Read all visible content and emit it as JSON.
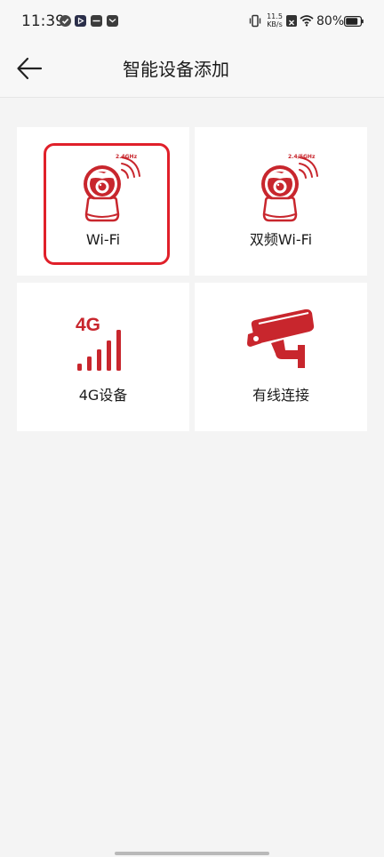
{
  "status_bar": {
    "time": "11:39",
    "net_speed_value": "11.5",
    "net_speed_unit": "KB/s",
    "battery": "80%"
  },
  "header": {
    "title": "智能设备添加",
    "back_icon": "arrow-left-icon"
  },
  "tiles": [
    {
      "label": "Wi-Fi",
      "icon": "camera-wifi-icon",
      "band": "2.4GHz",
      "selected": true
    },
    {
      "label": "双频Wi-Fi",
      "icon": "camera-dualband-icon",
      "band": "2.4/5GHz",
      "selected": false
    },
    {
      "label": "4G设备",
      "icon": "cellular-4g-icon",
      "badge": "4G",
      "selected": false
    },
    {
      "label": "有线连接",
      "icon": "cctv-camera-icon",
      "selected": false
    }
  ],
  "colors": {
    "accent": "#e0202a",
    "icon_red": "#c8262d",
    "background": "#f4f4f4",
    "tile": "#ffffff"
  }
}
